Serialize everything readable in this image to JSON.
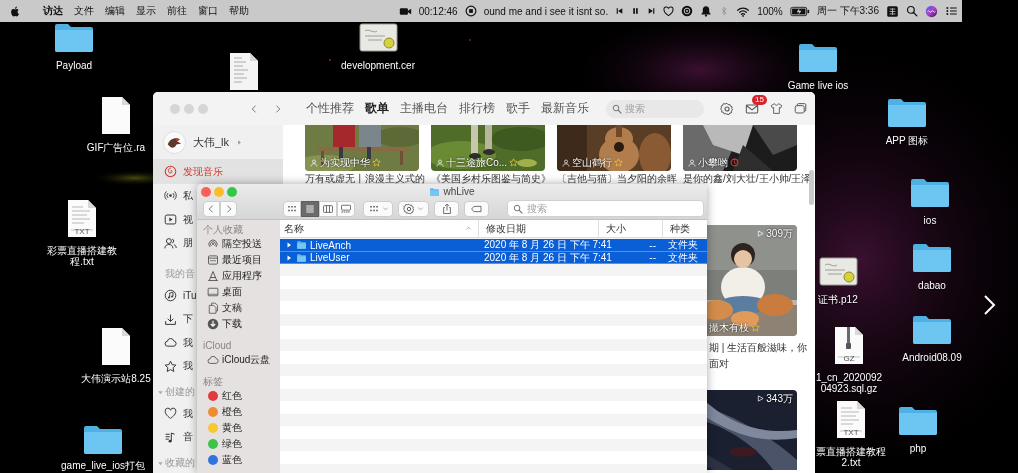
{
  "menu_bar": {
    "app_name": "访达",
    "menus": [
      "文件",
      "编辑",
      "显示",
      "前往",
      "窗口",
      "帮助"
    ],
    "recording_time": "00:12:46",
    "now_playing": "ound me and i see it isnt so.",
    "battery": "100%",
    "clock": "周一 下午3:36"
  },
  "desktop_icons": [
    {
      "kind": "folder",
      "label_lines": [
        "Payload"
      ]
    },
    {
      "kind": "document"
    },
    {
      "kind": "certificate",
      "label_lines": [
        "development.cer"
      ]
    },
    {
      "kind": "folder",
      "label_lines": [
        "Game live ios"
      ]
    },
    {
      "kind": "document",
      "label_lines": [
        "GIF广告位.ra"
      ]
    },
    {
      "kind": "folder",
      "label_lines": [
        "APP 图标"
      ]
    },
    {
      "kind": "text",
      "tag": "TXT",
      "label_lines": [
        "彩票直播搭建教",
        "程.txt"
      ]
    },
    {
      "kind": "folder",
      "label_lines": [
        "ios"
      ]
    },
    {
      "kind": "certificate",
      "label_lines": [
        "证书.p12"
      ]
    },
    {
      "kind": "folder",
      "label_lines": [
        "dabao"
      ]
    },
    {
      "kind": "archive",
      "tag": "GZ",
      "label_lines": [
        "1_cn_2020092",
        "04923.sql.gz"
      ]
    },
    {
      "kind": "folder",
      "label_lines": [
        "Android08.09"
      ]
    },
    {
      "kind": "document",
      "label_lines": [
        "大伟演示站8.25"
      ]
    },
    {
      "kind": "text",
      "tag": "TXT",
      "label_lines": [
        "票直播搭建教程",
        "2.txt"
      ]
    },
    {
      "kind": "folder",
      "label_lines": [
        "php"
      ]
    },
    {
      "kind": "folder",
      "label_lines": [
        "game_live_ios打包"
      ]
    }
  ],
  "music_window": {
    "tabs": [
      {
        "label": "个性推荐",
        "selected": false
      },
      {
        "label": "歌单",
        "selected": true
      },
      {
        "label": "主播电台",
        "selected": false
      },
      {
        "label": "排行榜",
        "selected": false
      },
      {
        "label": "歌手",
        "selected": false
      },
      {
        "label": "最新音乐",
        "selected": false
      }
    ],
    "search": {
      "placeholder": "搜索"
    },
    "mail_badge": "15",
    "user": {
      "name": "大伟_lk"
    },
    "sidebar": [
      {
        "kind": "item",
        "label": "发现音乐",
        "selected": true
      },
      {
        "kind": "item",
        "label": "私",
        "selected": false
      },
      {
        "kind": "item",
        "label": "视",
        "selected": false
      },
      {
        "kind": "item",
        "label": "朋",
        "selected": false
      },
      {
        "kind": "header",
        "label": "我的音"
      },
      {
        "kind": "item",
        "label": "iTu",
        "selected": false
      },
      {
        "kind": "item",
        "label": "下",
        "selected": false
      },
      {
        "kind": "item",
        "label": "我",
        "selected": false
      },
      {
        "kind": "item",
        "label": "我",
        "selected": false
      },
      {
        "kind": "header",
        "label": "创建的",
        "expanded": true
      },
      {
        "kind": "item",
        "label": "我",
        "selected": false
      },
      {
        "kind": "item",
        "label": "音",
        "selected": false
      },
      {
        "kind": "header",
        "label": "收藏的",
        "expanded": true
      }
    ],
    "playlists": [
      {
        "creator": "为实现中华",
        "caption": "万有或虚无丨浪漫主义式的"
      },
      {
        "creator": "十三途旅Co...",
        "caption": "《美国乡村乐图鉴与简史》"
      },
      {
        "creator": "空山鹤行",
        "caption": "〔吉他与猫〕当夕阳的余晖"
      },
      {
        "creator": "小攀哟",
        "caption": "是你的鑫/刘大壮/王小帅/王泽"
      }
    ],
    "more_playlists": [
      {
        "play_count": "309万",
        "creator": "撮木有枝",
        "caption_lines": [
          "期 | 生活百般滋味，你",
          "面对"
        ]
      },
      {
        "play_count": "343万"
      }
    ]
  },
  "finder": {
    "title": "whLive",
    "view_modes": [
      {
        "kind": "icons",
        "selected": false
      },
      {
        "kind": "list",
        "selected": true
      },
      {
        "kind": "columns",
        "selected": false
      },
      {
        "kind": "gallery",
        "selected": false
      }
    ],
    "search": {
      "placeholder": "搜索"
    },
    "sidebar": [
      {
        "header": "个人收藏",
        "items": [
          {
            "label": "隔空投送"
          },
          {
            "label": "最近项目"
          },
          {
            "label": "应用程序"
          },
          {
            "label": "桌面"
          },
          {
            "label": "文稿"
          },
          {
            "label": "下载"
          }
        ]
      },
      {
        "header": "iCloud",
        "items": [
          {
            "label": "iCloud云盘"
          }
        ]
      }
    ],
    "tags": {
      "header": "标签",
      "items": [
        {
          "label": "红色",
          "color": "#e5393f"
        },
        {
          "label": "橙色",
          "color": "#f08c30"
        },
        {
          "label": "黄色",
          "color": "#f5c932"
        },
        {
          "label": "绿色",
          "color": "#3cc44a"
        },
        {
          "label": "蓝色",
          "color": "#2f74e0"
        }
      ]
    },
    "columns": [
      {
        "label": "名称",
        "sorted": true
      },
      {
        "label": "修改日期"
      },
      {
        "label": "大小"
      },
      {
        "label": "种类"
      }
    ],
    "rows": [
      {
        "name": "LiveAnch",
        "modified": "2020 年 8 月 26 日 下午 7:41",
        "size": "--",
        "file_kind": "文件夹",
        "selected": true,
        "expanded": false
      },
      {
        "name": "LiveUser",
        "modified": "2020 年 8 月 26 日 下午 7:41",
        "size": "--",
        "file_kind": "文件夹",
        "selected": true,
        "expanded": false
      }
    ]
  }
}
